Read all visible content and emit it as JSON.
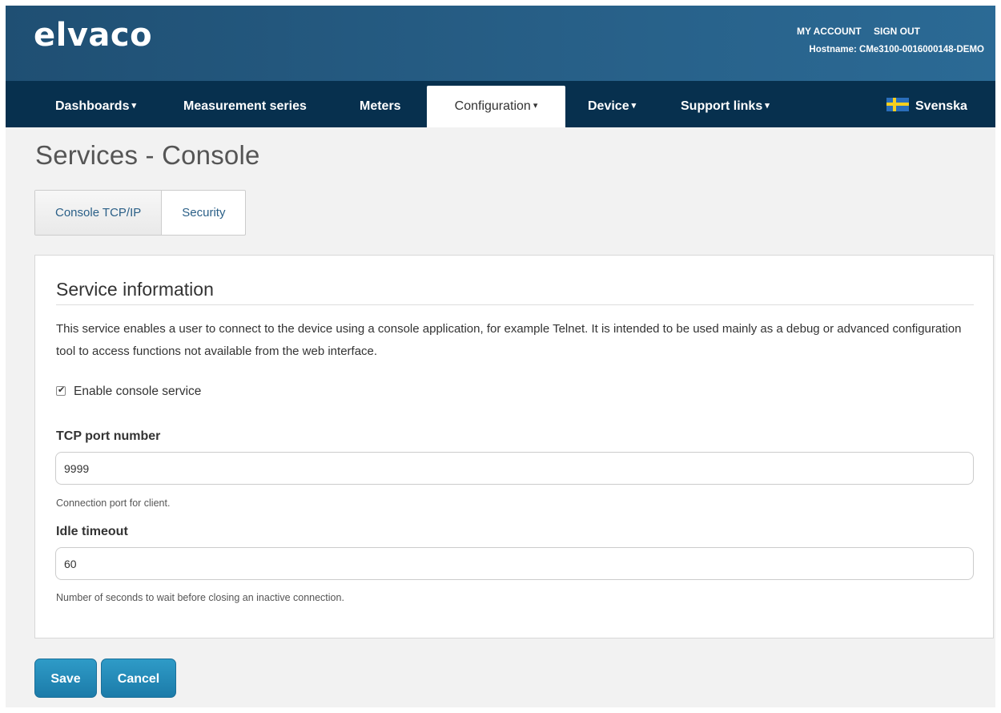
{
  "header": {
    "logo": "elvaco",
    "my_account": "MY ACCOUNT",
    "sign_out": "SIGN OUT",
    "hostname": "Hostname: CMe3100-0016000148-DEMO"
  },
  "nav": {
    "items": [
      {
        "label": "Dashboards",
        "caret": "▾"
      },
      {
        "label": "Measurement series"
      },
      {
        "label": "Meters"
      },
      {
        "label": "Configuration",
        "caret": "▾",
        "active": true
      },
      {
        "label": "Device",
        "caret": "▾"
      },
      {
        "label": "Support links",
        "caret": "▾"
      }
    ],
    "language": "Svenska"
  },
  "page": {
    "title": "Services - Console",
    "tabs": [
      {
        "label": "Console TCP/IP",
        "active": true
      },
      {
        "label": "Security"
      }
    ]
  },
  "service": {
    "title": "Service information",
    "description": "This service enables a user to connect to the device using a console application, for example Telnet. It is intended to be used mainly as a debug or advanced configuration tool to access functions not available from the web interface.",
    "enable_label": "Enable console service",
    "enable_checked": true,
    "tcp_port": {
      "label": "TCP port number",
      "value": "9999",
      "help": "Connection port for client."
    },
    "idle_timeout": {
      "label": "Idle timeout",
      "value": "60",
      "help": "Number of seconds to wait before closing an inactive connection."
    }
  },
  "actions": {
    "save": "Save",
    "cancel": "Cancel"
  },
  "colors": {
    "header": "#275f87",
    "navbar": "#07304e",
    "button": "#1c7ba9"
  }
}
